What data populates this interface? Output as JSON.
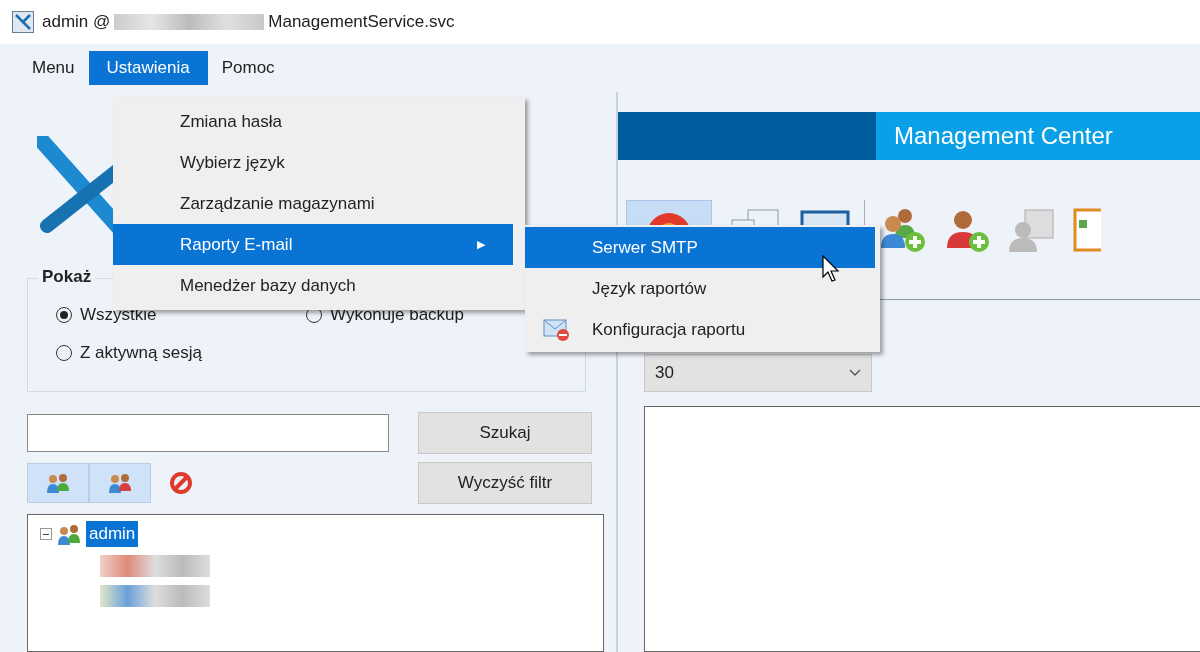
{
  "window": {
    "title_start": "admin @",
    "title_end": "ManagementService.svc"
  },
  "menubar": [
    {
      "label": "Menu",
      "selected": false
    },
    {
      "label": "Ustawienia",
      "selected": true
    },
    {
      "label": "Pomoc",
      "selected": false
    }
  ],
  "dropdown": [
    {
      "label": "Zmiana hasła",
      "selected": false
    },
    {
      "label": "Wybierz język",
      "selected": false
    },
    {
      "label": "Zarządzanie magazynami",
      "selected": false
    },
    {
      "label": "Raporty E-mail",
      "selected": true,
      "arrow": "▶"
    },
    {
      "label": "Menedżer bazy danych",
      "selected": false
    }
  ],
  "submenu": [
    {
      "label": "Serwer SMTP",
      "selected": true,
      "kind": "plain"
    },
    {
      "label": "Język raportów",
      "selected": false,
      "kind": "plain"
    },
    {
      "label": "Konfiguracja raportu",
      "selected": false,
      "kind": "icon"
    }
  ],
  "filter": {
    "title": "Pokaż",
    "options": [
      {
        "label": "Wszystkie",
        "selected": true
      },
      {
        "label": "Wykonuje backup",
        "selected": false
      },
      {
        "label": "Z aktywną sesją",
        "selected": false
      }
    ]
  },
  "search": {
    "button": "Szukaj",
    "clear_button": "Wyczyść filtr"
  },
  "view_toggles": [
    {
      "selected": true
    },
    {
      "selected": true
    }
  ],
  "tree": [
    {
      "label": "admin",
      "selected": true,
      "expanded": true
    }
  ],
  "banner": {
    "title": "Management Center"
  },
  "toolbar": [
    {
      "selected": true
    }
  ],
  "page_size": {
    "value": "30"
  }
}
